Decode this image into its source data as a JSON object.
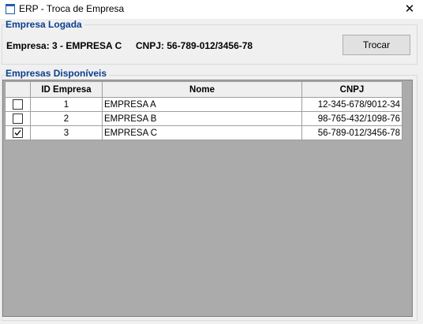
{
  "window": {
    "title": "ERP - Troca de Empresa",
    "close_glyph": "✕"
  },
  "logged": {
    "group_title": "Empresa Logada",
    "empresa_text": "Empresa:  3 - EMPRESA C",
    "cnpj_text": "CNPJ: 56-789-012/3456-78",
    "switch_label": "Trocar"
  },
  "available": {
    "group_title": "Empresas Disponíveis",
    "columns": [
      "",
      "ID Empresa",
      "Nome",
      "CNPJ"
    ],
    "rows": [
      {
        "checked": false,
        "id": "1",
        "nome": "EMPRESA A",
        "cnpj": "12-345-678/9012-34"
      },
      {
        "checked": false,
        "id": "2",
        "nome": "EMPRESA B",
        "cnpj": "98-765-432/1098-76"
      },
      {
        "checked": true,
        "id": "3",
        "nome": "EMPRESA C",
        "cnpj": "56-789-012/3456-78"
      }
    ]
  },
  "colors": {
    "group_title": "#0b3f8f",
    "grid_empty": "#ababab"
  }
}
